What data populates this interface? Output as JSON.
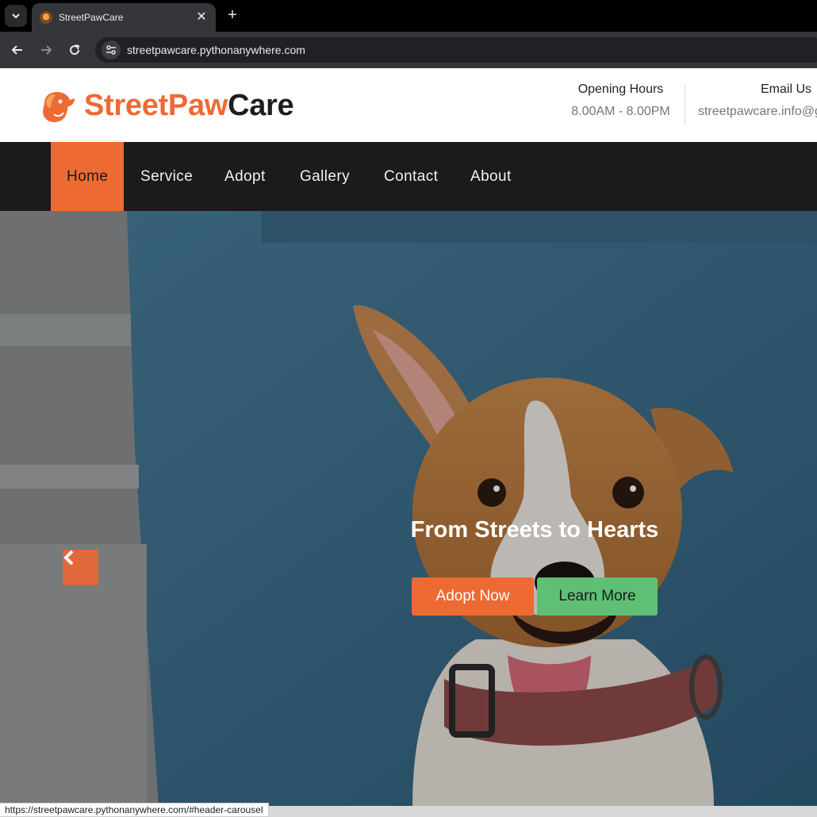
{
  "browser": {
    "tab_title": "StreetPawCare",
    "tab_close": "✕",
    "new_tab": "+",
    "url": "streetpawcare.pythonanywhere.com",
    "status_url": "https://streetpawcare.pythonanywhere.com/#header-carousel"
  },
  "header": {
    "brand_part1": "StreetPaw",
    "brand_part2": "Care",
    "opening_hours_label": "Opening Hours",
    "opening_hours_value": "8.00AM - 8.00PM",
    "email_label": "Email Us",
    "email_value": "streetpawcare.info@gmail.com"
  },
  "nav": {
    "items": [
      {
        "label": "Home",
        "active": true
      },
      {
        "label": "Service"
      },
      {
        "label": "Adopt"
      },
      {
        "label": "Gallery"
      },
      {
        "label": "Contact"
      },
      {
        "label": "About"
      }
    ]
  },
  "hero": {
    "title": "From Streets to Hearts",
    "adopt_button": "Adopt Now",
    "learn_button": "Learn More"
  },
  "colors": {
    "brand_orange": "#ee6a33",
    "brand_green": "#5fbf74",
    "nav_bg": "#1b1b1b"
  }
}
